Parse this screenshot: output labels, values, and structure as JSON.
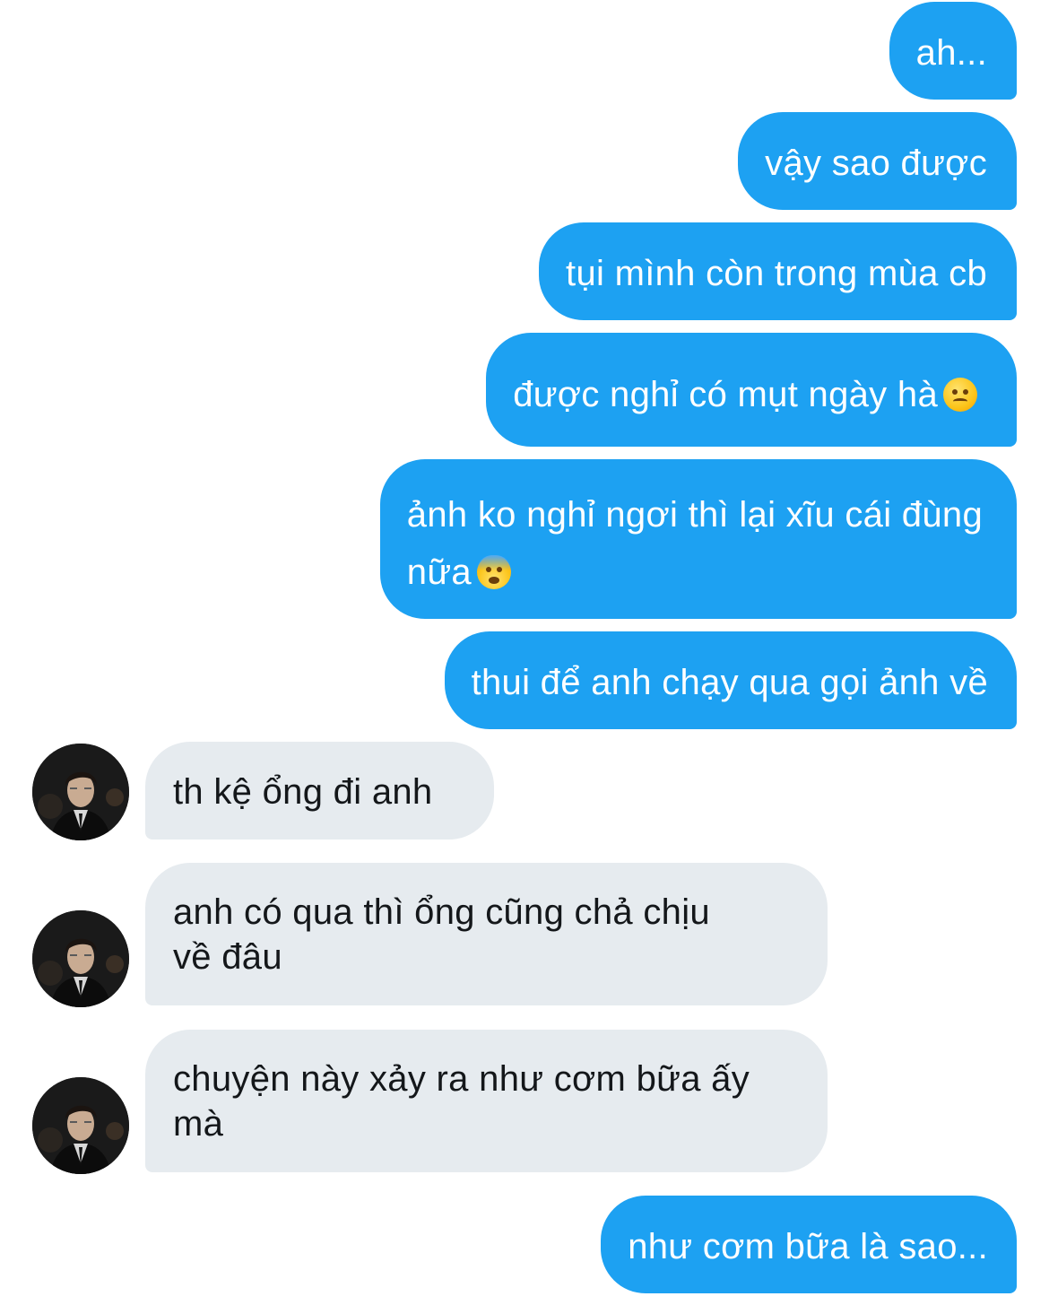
{
  "messages": [
    {
      "id": "m1",
      "side": "sent",
      "text": "ah..."
    },
    {
      "id": "m2",
      "side": "sent",
      "text": "vậy sao được"
    },
    {
      "id": "m3",
      "side": "sent",
      "text": "tụi mình còn trong mùa cb"
    },
    {
      "id": "m4",
      "side": "sent",
      "text": "được nghỉ có mụt ngày hà",
      "emoji": "confounded-face"
    },
    {
      "id": "m5",
      "side": "sent",
      "text": "ảnh ko nghỉ ngơi thì lại xĩu cái đùng\nnữa",
      "emoji": "anxious-face-with-sweat"
    },
    {
      "id": "m6",
      "side": "sent",
      "text": "thui để anh chạy qua gọi ảnh về"
    },
    {
      "id": "m7",
      "side": "received",
      "text": "th kệ ổng đi anh"
    },
    {
      "id": "m8",
      "side": "received",
      "text": "anh có qua thì ổng cũng chả chịu\nvề đâu"
    },
    {
      "id": "m9",
      "side": "received",
      "text": "chuyện này xảy ra như cơm bữa ấy\nmà"
    },
    {
      "id": "m10",
      "side": "sent",
      "text": "như cơm bữa là sao..."
    }
  ],
  "colors": {
    "sent_bubble": "#1da1f2",
    "received_bubble": "#e6ebef",
    "background": "#ffffff"
  }
}
